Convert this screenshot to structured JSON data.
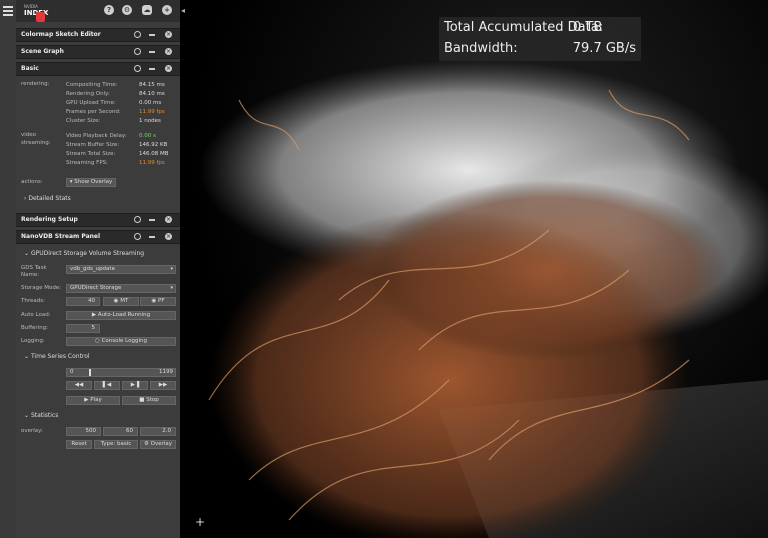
{
  "app": {
    "logo_brand": "NVIDIA",
    "logo_name": "INDEX"
  },
  "panels": {
    "colormap": "Colormap Sketch Editor",
    "scene_graph": "Scene Graph",
    "basic": "Basic",
    "rendering_setup": "Rendering Setup",
    "nanovdb": "NanoVDB Stream Panel"
  },
  "basic": {
    "rendering_label": "rendering:",
    "rendering": [
      {
        "label": "Compositing Time:",
        "value": "84.15 ms"
      },
      {
        "label": "Rendering Only:",
        "value": "84.10 ms"
      },
      {
        "label": "GPU Upload Time:",
        "value": "0.00 ms"
      },
      {
        "label": "Frames per Second:",
        "value": "11.99 fps"
      },
      {
        "label": "Cluster Size:",
        "value": "1 nodes"
      }
    ],
    "video_label_1": "video",
    "video_label_2": "streaming:",
    "video": [
      {
        "label": "Video Playback Delay:",
        "value": "0.00 s"
      },
      {
        "label": "Stream Buffer Size:",
        "value": "146.92 KB"
      },
      {
        "label": "Stream Total Size:",
        "value": "146.08 MB"
      },
      {
        "label": "Streaming FPS:",
        "value": "11.99 fps"
      }
    ],
    "actions_label": "actions:",
    "show_overlay": "Show Overlay",
    "detailed_stats": "Detailed Stats"
  },
  "gds": {
    "section": "GPUDirect Storage Volume Streaming",
    "task_label_1": "GDS Task",
    "task_label_2": "Name:",
    "task_value": "vdb_gds_update",
    "storage_label": "Storage Mode:",
    "storage_value": "GPUDirect Storage",
    "threads_label": "Threads:",
    "threads_value": "40",
    "mt": "MT",
    "pf": "PF",
    "autoload_label": "Auto Load:",
    "autoload_button": "Auto-Load Running",
    "buffering_label": "Buffering:",
    "buffering_value": "5",
    "logging_label": "Logging:",
    "logging_button": "Console Logging"
  },
  "timeseries": {
    "section": "Time Series Control",
    "start": "0",
    "end": "1199",
    "play": "Play",
    "stop": "Stop"
  },
  "statistics": {
    "section": "Statistics",
    "overlay_label": "overlay:",
    "v1": "500",
    "v2": "60",
    "v3": "2.0",
    "reset": "Reset",
    "type": "Type: basic",
    "overlay_btn": "Overlay"
  },
  "viewport_overlay": {
    "accum_label": "Total Accumulated Data:",
    "accum_value": "0 TB",
    "bw_label": "Bandwidth:",
    "bw_value": "79.7 GB/s"
  },
  "colors": {
    "panel_bg": "#3c3c3c",
    "header_bg": "#2a2a2a",
    "accent_green": "#7ed957",
    "accent_orange": "#e08b2a"
  }
}
